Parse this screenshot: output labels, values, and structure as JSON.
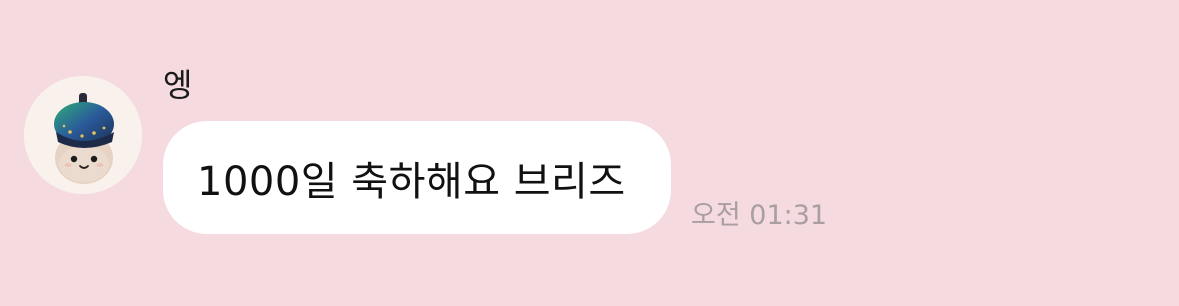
{
  "message": {
    "sender": {
      "name": "엥",
      "avatar_icon": "mushroom-plush-avatar-icon"
    },
    "text": "1000일 축하해요 브리즈",
    "time": "오전 01:31"
  },
  "colors": {
    "background": "#f5dbe0",
    "bubble": "#ffffff",
    "timestamp": "#a99ea2"
  }
}
